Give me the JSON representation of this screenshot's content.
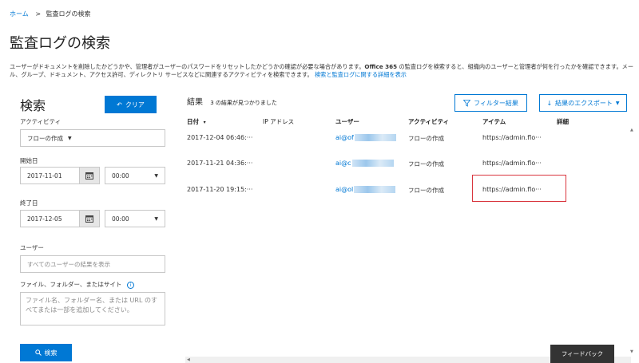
{
  "breadcrumb": {
    "home": "ホーム",
    "separator": ">",
    "current": "監査ログの検索"
  },
  "page_title": "監査ログの検索",
  "description": {
    "part1": "ユーザーがドキュメントを削除したかどうかや、管理者がユーザーのパスワードをリセットしたかどうかの確認が必要な場合があります。",
    "bold": "Office 365",
    "part2": " の監査ログを検索すると、組織内のユーザーと管理者が何を行ったかを確認できます。メール、グループ、ドキュメント、アクセス許可、ディレクトリ サービスなどに関連するアクティビティを検索できます。",
    "link": "検索と監査ログに関する詳細を表示"
  },
  "search_panel": {
    "title": "検索",
    "clear_label": "クリア",
    "activity_label": "アクティビティ",
    "activity_value": "フローの作成",
    "start_date_label": "開始日",
    "start_date": "2017-11-01",
    "start_time": "00:00",
    "end_date_label": "終了日",
    "end_date": "2017-12-05",
    "end_time": "00:00",
    "users_label": "ユーザー",
    "users_placeholder": "すべてのユーザーの結果を表示",
    "files_label": "ファイル、フォルダー、またはサイト",
    "files_placeholder": "ファイル名、フォルダー名、または URL のすべてまたは一部を追加してください。",
    "search_label": "検索"
  },
  "results": {
    "title": "結果",
    "count_text": "3 の結果が見つかりました",
    "filter_label": "フィルター結果",
    "export_label": "結果のエクスポート",
    "columns": [
      "日付",
      "IP アドレス",
      "ユーザー",
      "アクティビティ",
      "アイテム",
      "詳細"
    ],
    "date_sort_glyph": "▾",
    "rows": [
      {
        "date": "2017-12-04 06:46:···",
        "ip": "",
        "user": "ai@of",
        "activity": "フローの作成",
        "item": "https://admin.flo···"
      },
      {
        "date": "2017-11-21 04:36:···",
        "ip": "",
        "user": "ai@c",
        "activity": "フローの作成",
        "item": "https://admin.flo···"
      },
      {
        "date": "2017-11-20 19:15:···",
        "ip": "",
        "user": "ai@ol",
        "activity": "フローの作成",
        "item": "https://admin.flo···"
      }
    ]
  },
  "feedback_label": "フィードバック",
  "colors": {
    "accent": "#0078d4",
    "highlight": "#d9363e",
    "feedback_bg": "#333333"
  }
}
